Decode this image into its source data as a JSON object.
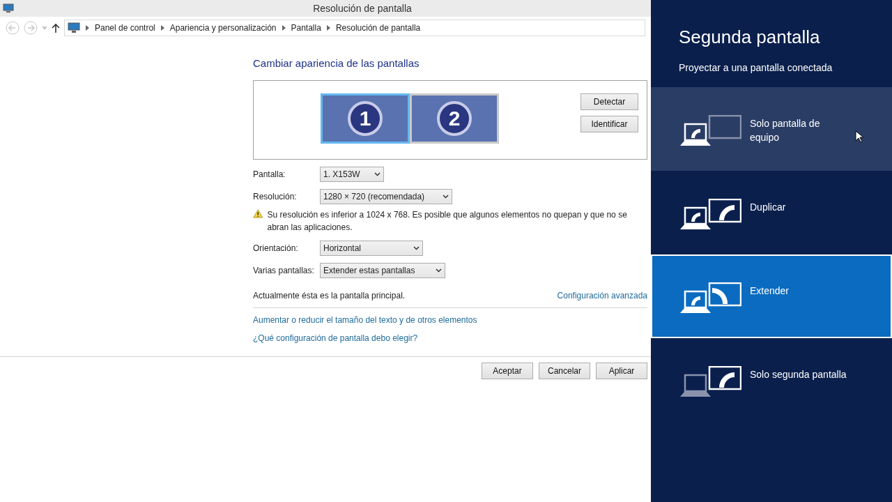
{
  "window": {
    "title": "Resolución de pantalla"
  },
  "breadcrumb": [
    "Panel de control",
    "Apariencia y personalización",
    "Pantalla",
    "Resolución de pantalla"
  ],
  "heading": "Cambiar apariencia de las pantallas",
  "monitors": [
    {
      "label": "1",
      "selected": true
    },
    {
      "label": "2",
      "selected": false
    }
  ],
  "side_buttons": [
    "Detectar",
    "Identificar"
  ],
  "fields": [
    {
      "label": "Pantalla:",
      "value": "1. X153W"
    },
    {
      "label": "Resolución:",
      "value": "1280 × 720 (recomendada)"
    },
    {
      "label": "Orientación:",
      "value": "Horizontal"
    },
    {
      "label": "Varias pantallas:",
      "value": "Extender estas pantallas"
    }
  ],
  "warning": "Su resolución es inferior a 1024 x 768. Es posible que algunos elementos no quepan y que no se abran las aplicaciones.",
  "main_display_note": "Actualmente ésta es la pantalla principal.",
  "advanced_link": "Configuración avanzada",
  "links": [
    "Aumentar o reducir el tamaño del texto y de otros elementos",
    "¿Qué configuración de pantalla debo elegir?"
  ],
  "buttons": [
    "Aceptar",
    "Cancelar",
    "Aplicar"
  ],
  "projection_panel": {
    "title": "Segunda pantalla",
    "subtitle": "Proyectar a una pantalla conectada",
    "options": [
      {
        "kind": "pc_only",
        "label": "Solo pantalla de equipo",
        "selected": false,
        "hovered": true
      },
      {
        "kind": "duplicate",
        "label": "Duplicar",
        "selected": false,
        "hovered": false
      },
      {
        "kind": "extend",
        "label": "Extender",
        "selected": true,
        "hovered": false
      },
      {
        "kind": "second_only",
        "label": "Solo segunda pantalla",
        "selected": false,
        "hovered": false
      }
    ]
  }
}
